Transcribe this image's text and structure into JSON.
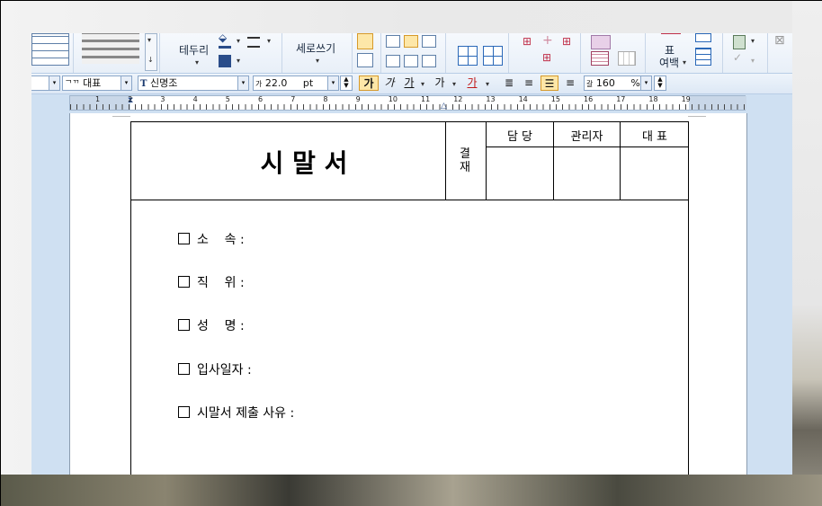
{
  "ribbon": {
    "border_label": "테두리",
    "vertical_text_label": "세로쓰기",
    "table_label": "표",
    "margin_label": "여백"
  },
  "format_bar": {
    "style_value": "대표",
    "font_value": "신명조",
    "size_value": "22.0",
    "size_unit": "pt",
    "bold_glyph": "가",
    "italic_glyph": "가",
    "underline_glyph": "가",
    "strike_glyph": "가",
    "color_glyph": "가",
    "line_spacing_value": "160",
    "line_spacing_unit": "%"
  },
  "ruler": {
    "numbers": [
      "1",
      "2",
      "3",
      "4",
      "5",
      "6",
      "7",
      "8",
      "9",
      "10",
      "11",
      "12",
      "13",
      "14",
      "15",
      "16",
      "17",
      "18",
      "19"
    ]
  },
  "document": {
    "title": "시 말 서",
    "approval_label": "결재",
    "approval_cols": [
      "담 당",
      "관리자",
      "대 표"
    ],
    "fields": [
      "소    속 :",
      "직    위 :",
      "성    명 :",
      "입사일자 :",
      "시말서 제출 사유 :"
    ]
  }
}
